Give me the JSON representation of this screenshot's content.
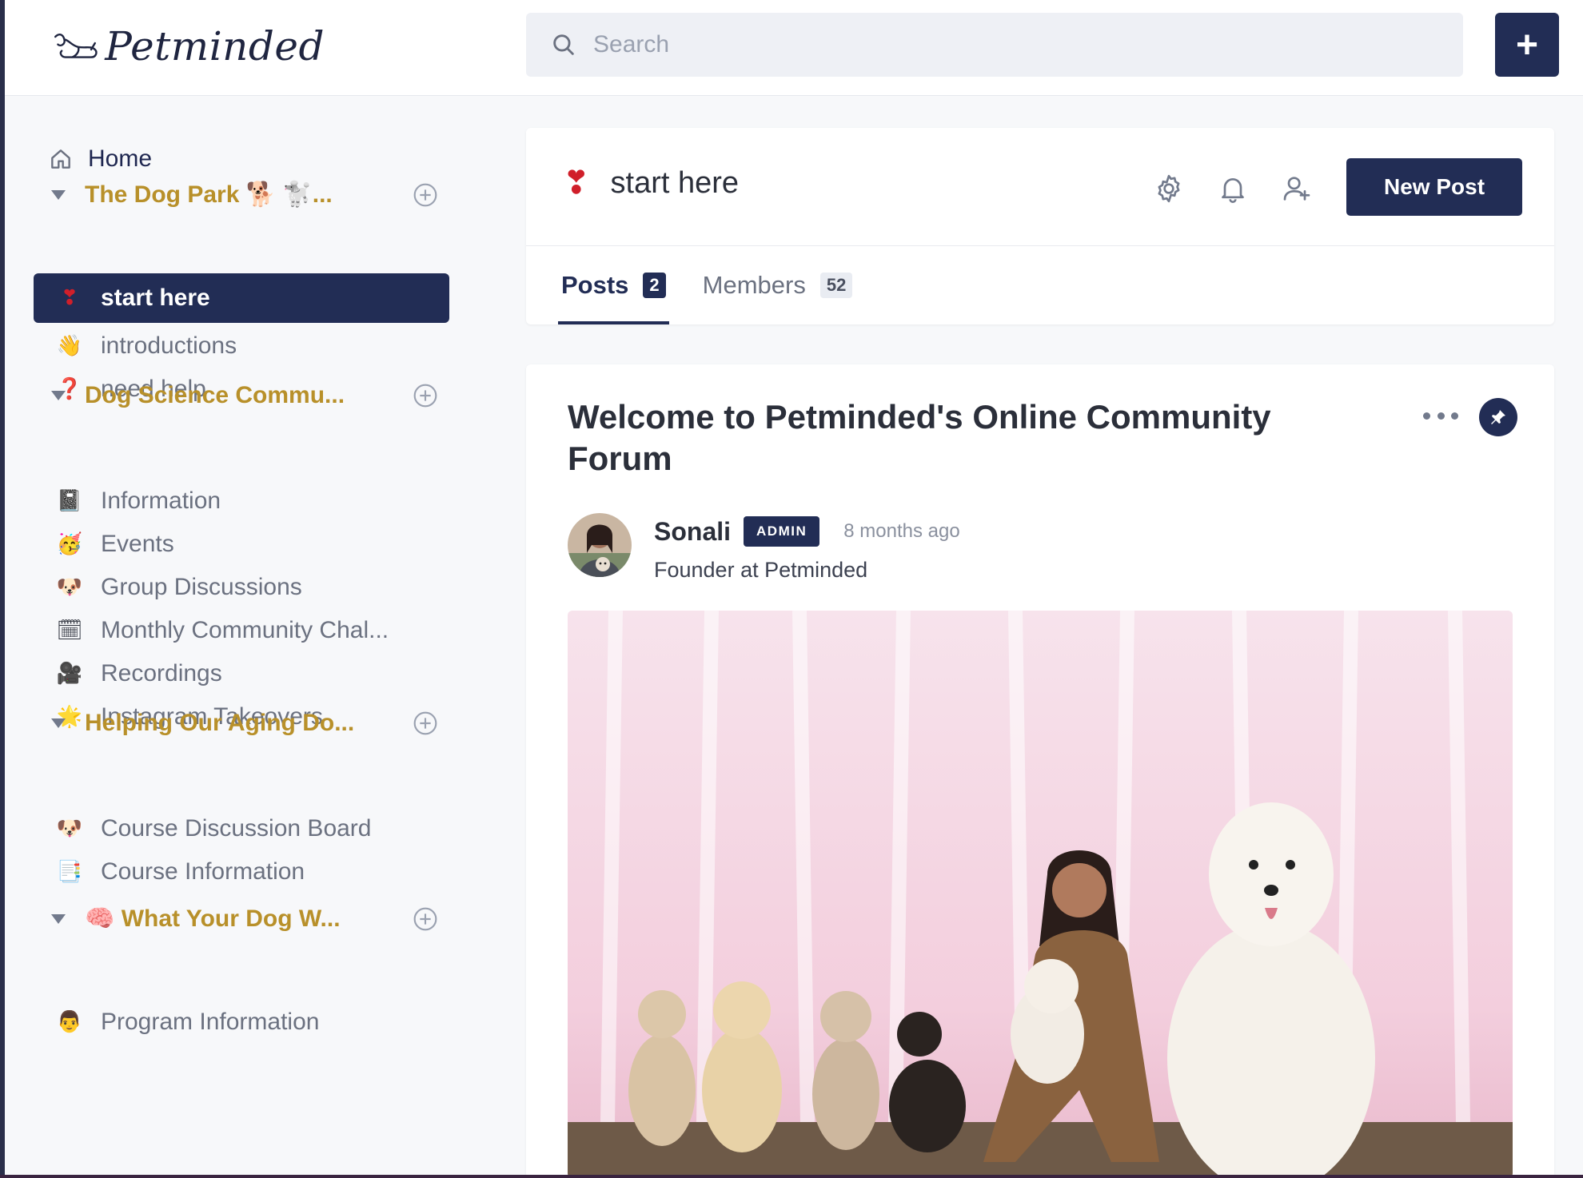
{
  "brand": {
    "name": "Petminded"
  },
  "search": {
    "placeholder": "Search"
  },
  "header": {
    "add_label": "+"
  },
  "sidebar": {
    "home_label": "Home",
    "groups": [
      {
        "title": "The Dog Park 🐕 🐩...",
        "channels": [
          {
            "emoji": "❣",
            "label": "start here",
            "active": true
          },
          {
            "emoji": "👋",
            "label": "introductions"
          },
          {
            "emoji": "❓",
            "label": "need help"
          }
        ]
      },
      {
        "title": "Dog Science Commu...",
        "channels": [
          {
            "emoji": "📓",
            "label": "Information"
          },
          {
            "emoji": "🥳",
            "label": "Events"
          },
          {
            "emoji": "🐶",
            "label": "Group Discussions"
          },
          {
            "emoji": "🗓",
            "label": "Monthly Community Chal..."
          },
          {
            "emoji": "🎥",
            "label": "Recordings"
          },
          {
            "emoji": "🌟",
            "label": "Instagram Takeovers"
          }
        ]
      },
      {
        "title": "Helping Our Aging Do...",
        "channels": [
          {
            "emoji": "🐶",
            "label": "Course Discussion Board"
          },
          {
            "emoji": "📑",
            "label": "Course Information"
          }
        ]
      },
      {
        "title": "🧠 What Your Dog W...",
        "channels": [
          {
            "emoji": "👨",
            "label": "Program Information"
          }
        ]
      }
    ]
  },
  "space": {
    "emoji": "❣",
    "title": "start here",
    "new_post_label": "New Post",
    "tabs": [
      {
        "label": "Posts",
        "count": "2",
        "active": true
      },
      {
        "label": "Members",
        "count": "52"
      }
    ]
  },
  "post": {
    "title": "Welcome to Petminded's Online Community Forum",
    "author": "Sonali",
    "badge": "ADMIN",
    "time": "8 months ago",
    "role": "Founder at Petminded"
  },
  "colors": {
    "accent": "#222d55",
    "group_title": "#b8902a"
  }
}
